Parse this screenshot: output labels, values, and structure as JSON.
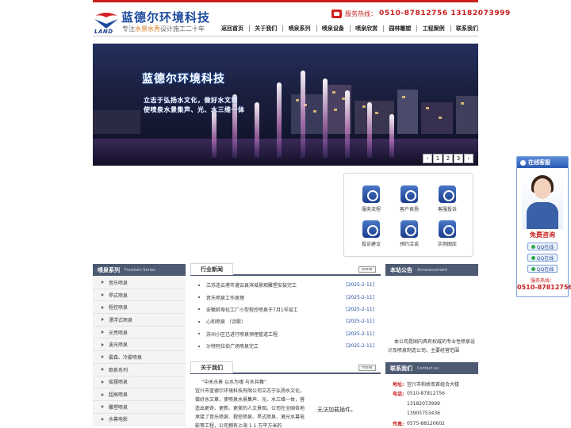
{
  "header": {
    "brand_title": "蓝德尔环境科技",
    "brand_en": "LAND",
    "slogan_pre": "专注",
    "slogan_hl": "水景水秀",
    "slogan_post": "设计施工二十年",
    "hotline_label": "服务热线：",
    "hotline_numbers": "0510-87812756  13182073999"
  },
  "nav": [
    "返回首页",
    "关于我们",
    "喷泉系列",
    "喷泉设备",
    "喷泉欣赏",
    "园林雕塑",
    "工程案例",
    "联系我们"
  ],
  "banner": {
    "title": "蓝德尔环境科技",
    "line1": "立志于弘扬水文化，做好水文章",
    "line2": "使喷泉水景集声、光、水三维一体",
    "pages": [
      "‹",
      "1",
      "2",
      "3",
      "›"
    ]
  },
  "services": [
    {
      "label": "服务流程",
      "icon": "process-icon"
    },
    {
      "label": "客户表扬",
      "icon": "praise-icon"
    },
    {
      "label": "客服投诉",
      "icon": "complaint-icon"
    },
    {
      "label": "投诉建议",
      "icon": "suggestion-icon"
    },
    {
      "label": "预约洽谈",
      "icon": "appointment-icon"
    },
    {
      "label": "实例图库",
      "icon": "gallery-icon"
    }
  ],
  "sidebar": {
    "title": "喷泉系列",
    "subtitle": "Fountain Series",
    "items": [
      "音乐喷泉",
      "旱式喷泉",
      "程控喷泉",
      "漂浮式喷泉",
      "光亮喷泉",
      "波光喷泉",
      "雾森、冷雾喷泉",
      "跑泉系列",
      "摇摆喷泉",
      "超高喷泉",
      "雕塑喷泉",
      "水幕电影"
    ]
  },
  "news": {
    "title": "行业新闻",
    "more": "more",
    "items": [
      {
        "title": "江苏连云港市灌云县滨城景观雕塑安装完工",
        "date": "[2025-2-11]"
      },
      {
        "title": "音乐喷泉工作原理",
        "date": "[2025-2-11]"
      },
      {
        "title": "安徽蚌埠化工厂小型程控喷泉于7月1号竣工",
        "date": "[2025-2-11]"
      },
      {
        "title": "心和喷泉 （诗歌）",
        "date": "[2025-2-11]"
      },
      {
        "title": "苏州小区已进行喷泉预埋管道工程",
        "date": "[2025-2-11]"
      },
      {
        "title": "沙特阿拉伯广场喷泉完工",
        "date": "[2025-2-11]"
      }
    ]
  },
  "notice": {
    "title": "本站公告",
    "subtitle": "Announcement",
    "body": "本公司是国内具有权威的专业性喷泉设计及喷泉制造公司。主要经营范围"
  },
  "about": {
    "title": "关于我们",
    "more": "more",
    "motto": "“中禾水景 以水为魂 与水共舞”",
    "body": "宜兴市蓝德尔环境科技有限公司立志于弘扬水文化，做好水文章，使喷泉水景集声、光、水三维一体，营造出更奇、更新、更美的人文景观。公司在全国各地承接了音乐喷泉、程控喷泉、旱式喷泉、激光水幕电影等工程，公司拥有上海 1 1 万平方米的",
    "video_placeholder": "无法加载插件。"
  },
  "contact": {
    "title": "联系我们",
    "subtitle": "Contact us",
    "rows": [
      {
        "key": "地址:",
        "value": "宜兴市和桥南首组合大楼"
      },
      {
        "key": "电话:",
        "value": "0510-87812756"
      },
      {
        "key": "",
        "value": "13182073999"
      },
      {
        "key": "",
        "value": "13905753436"
      },
      {
        "key": "传真:",
        "value": "0575-88120602"
      }
    ]
  },
  "float": {
    "title": "在线客服",
    "consult": "免费咨询",
    "qq": [
      "QQ在线",
      "QQ在线",
      "QQ在线"
    ],
    "hotline_label": "服务热线：",
    "hotline_number": "0510-87812756"
  }
}
